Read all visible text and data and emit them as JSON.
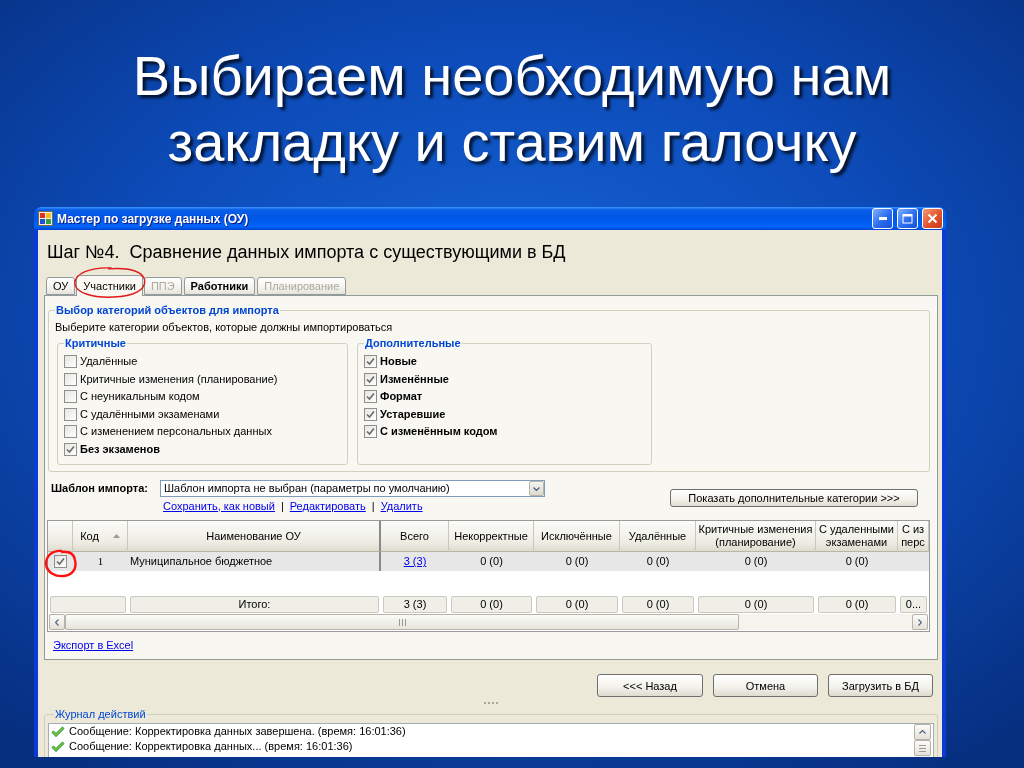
{
  "slide": {
    "title": "Выбираем необходимую нам закладку и ставим галочку"
  },
  "window": {
    "title": "Мастер по загрузке данных (ОУ)",
    "step_title": "Шаг №4.  Сравнение данных импорта с существующими в БД"
  },
  "tabs": [
    {
      "label": "ОУ",
      "selected": false,
      "disabled": false,
      "highlighted": false,
      "circled": false
    },
    {
      "label": "Участники",
      "selected": true,
      "disabled": false,
      "highlighted": false,
      "circled": true
    },
    {
      "label": "ППЭ",
      "selected": false,
      "disabled": true,
      "highlighted": false,
      "circled": false
    },
    {
      "label": "Работники",
      "selected": false,
      "disabled": false,
      "highlighted": true,
      "circled": false
    },
    {
      "label": "Планирование",
      "selected": false,
      "disabled": true,
      "highlighted": false,
      "circled": false
    }
  ],
  "categories": {
    "title": "Выбор категорий объектов для импорта",
    "description": "Выберите категории объектов, которые должны импортироваться",
    "groups": [
      {
        "title": "Критичные",
        "items": [
          {
            "label": "Удалённые",
            "checked": false
          },
          {
            "label": "Критичные изменения (планирование)",
            "checked": false
          },
          {
            "label": "С неуникальным кодом",
            "checked": false
          },
          {
            "label": "С удалёнными экзаменами",
            "checked": false
          },
          {
            "label": "С изменением персональных данных",
            "checked": false
          },
          {
            "label": "Без экзаменов",
            "checked": true
          }
        ]
      },
      {
        "title": "Дополнительные",
        "items": [
          {
            "label": "Новые",
            "checked": true
          },
          {
            "label": "Изменённые",
            "checked": true
          },
          {
            "label": "Формат",
            "checked": true
          },
          {
            "label": "Устаревшие",
            "checked": true
          },
          {
            "label": "С изменённым кодом",
            "checked": true
          }
        ]
      }
    ]
  },
  "template": {
    "label": "Шаблон импорта:",
    "value": "Шаблон импорта не выбран (параметры по умолчанию)",
    "links": [
      "Сохранить, как новый",
      "Редактировать",
      "Удалить"
    ],
    "separators": [
      "|",
      "|"
    ],
    "more_button": "Показать дополнительные категории >>>"
  },
  "table": {
    "columns": [
      {
        "label": "Код",
        "kind": "code",
        "sorted": true
      },
      {
        "label": "Наименование ОУ",
        "kind": "name",
        "sorted": false
      },
      {
        "label": "Всего",
        "kind": "count",
        "sorted": false
      },
      {
        "label": "Некорректные",
        "kind": "count",
        "sorted": false
      },
      {
        "label": "Исключённые",
        "kind": "count",
        "sorted": false
      },
      {
        "label": "Удалённые",
        "kind": "count",
        "sorted": false
      },
      {
        "label": "Критичные изменения (планирование)",
        "kind": "count",
        "sorted": false
      },
      {
        "label": "С удаленными экзаменами",
        "kind": "count",
        "sorted": false
      },
      {
        "label": "С из перс",
        "kind": "count",
        "sorted": false
      }
    ],
    "rows": [
      {
        "checked": true,
        "circled": true,
        "cells": [
          {
            "text": "1",
            "kind": "text"
          },
          {
            "text": "Муниципальное бюджетное",
            "kind": "text"
          },
          {
            "text": "3 (3)",
            "kind": "link"
          },
          {
            "text": "0 (0)",
            "kind": "text"
          },
          {
            "text": "0 (0)",
            "kind": "text"
          },
          {
            "text": "0 (0)",
            "kind": "text"
          },
          {
            "text": "0 (0)",
            "kind": "text"
          },
          {
            "text": "0 (0)",
            "kind": "text"
          }
        ]
      }
    ],
    "totals": {
      "label": "Итого:",
      "cells": [
        "3 (3)",
        "0 (0)",
        "0 (0)",
        "0 (0)",
        "0 (0)",
        "0 (0)",
        "0..."
      ]
    }
  },
  "export_link": "Экспорт в Excel",
  "buttons": [
    "<<< Назад",
    "Отмена",
    "Загрузить в БД"
  ],
  "log": {
    "title": "Журнал действий",
    "entries": [
      {
        "kind": "success",
        "text": "Сообщение: Корректировка данных завершена. (время: 16:01:36)"
      },
      {
        "kind": "success",
        "text": "Сообщение: Корректировка данных... (время: 16:01:36)"
      }
    ]
  }
}
